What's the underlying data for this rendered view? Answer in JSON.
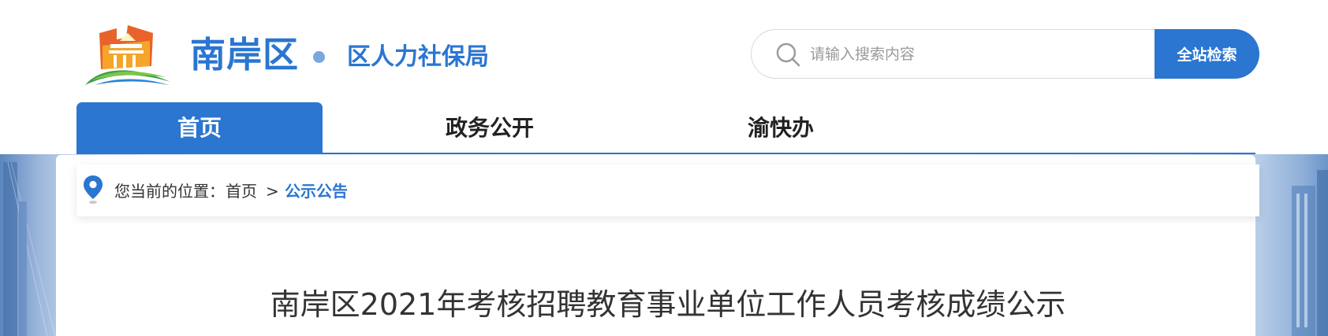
{
  "header": {
    "logo_icon": "tiananmen-style-emblem",
    "site_name": "南岸区",
    "bureau_name": "区人力社保局",
    "accent_color": "#2a76d0"
  },
  "search": {
    "placeholder": "请输入搜索内容",
    "value": "",
    "button_label": "全站检索",
    "icon": "search-icon"
  },
  "nav": {
    "items": [
      {
        "label": "首页",
        "active": true
      },
      {
        "label": "政务公开",
        "active": false
      },
      {
        "label": "渝快办",
        "active": false
      }
    ]
  },
  "breadcrumb": {
    "icon": "location-pin-icon",
    "prefix": "您当前的位置：",
    "home": "首页",
    "separator": ">",
    "current": "公示公告"
  },
  "article": {
    "title": "南岸区2021年考核招聘教育事业单位工作人员考核成绩公示"
  }
}
